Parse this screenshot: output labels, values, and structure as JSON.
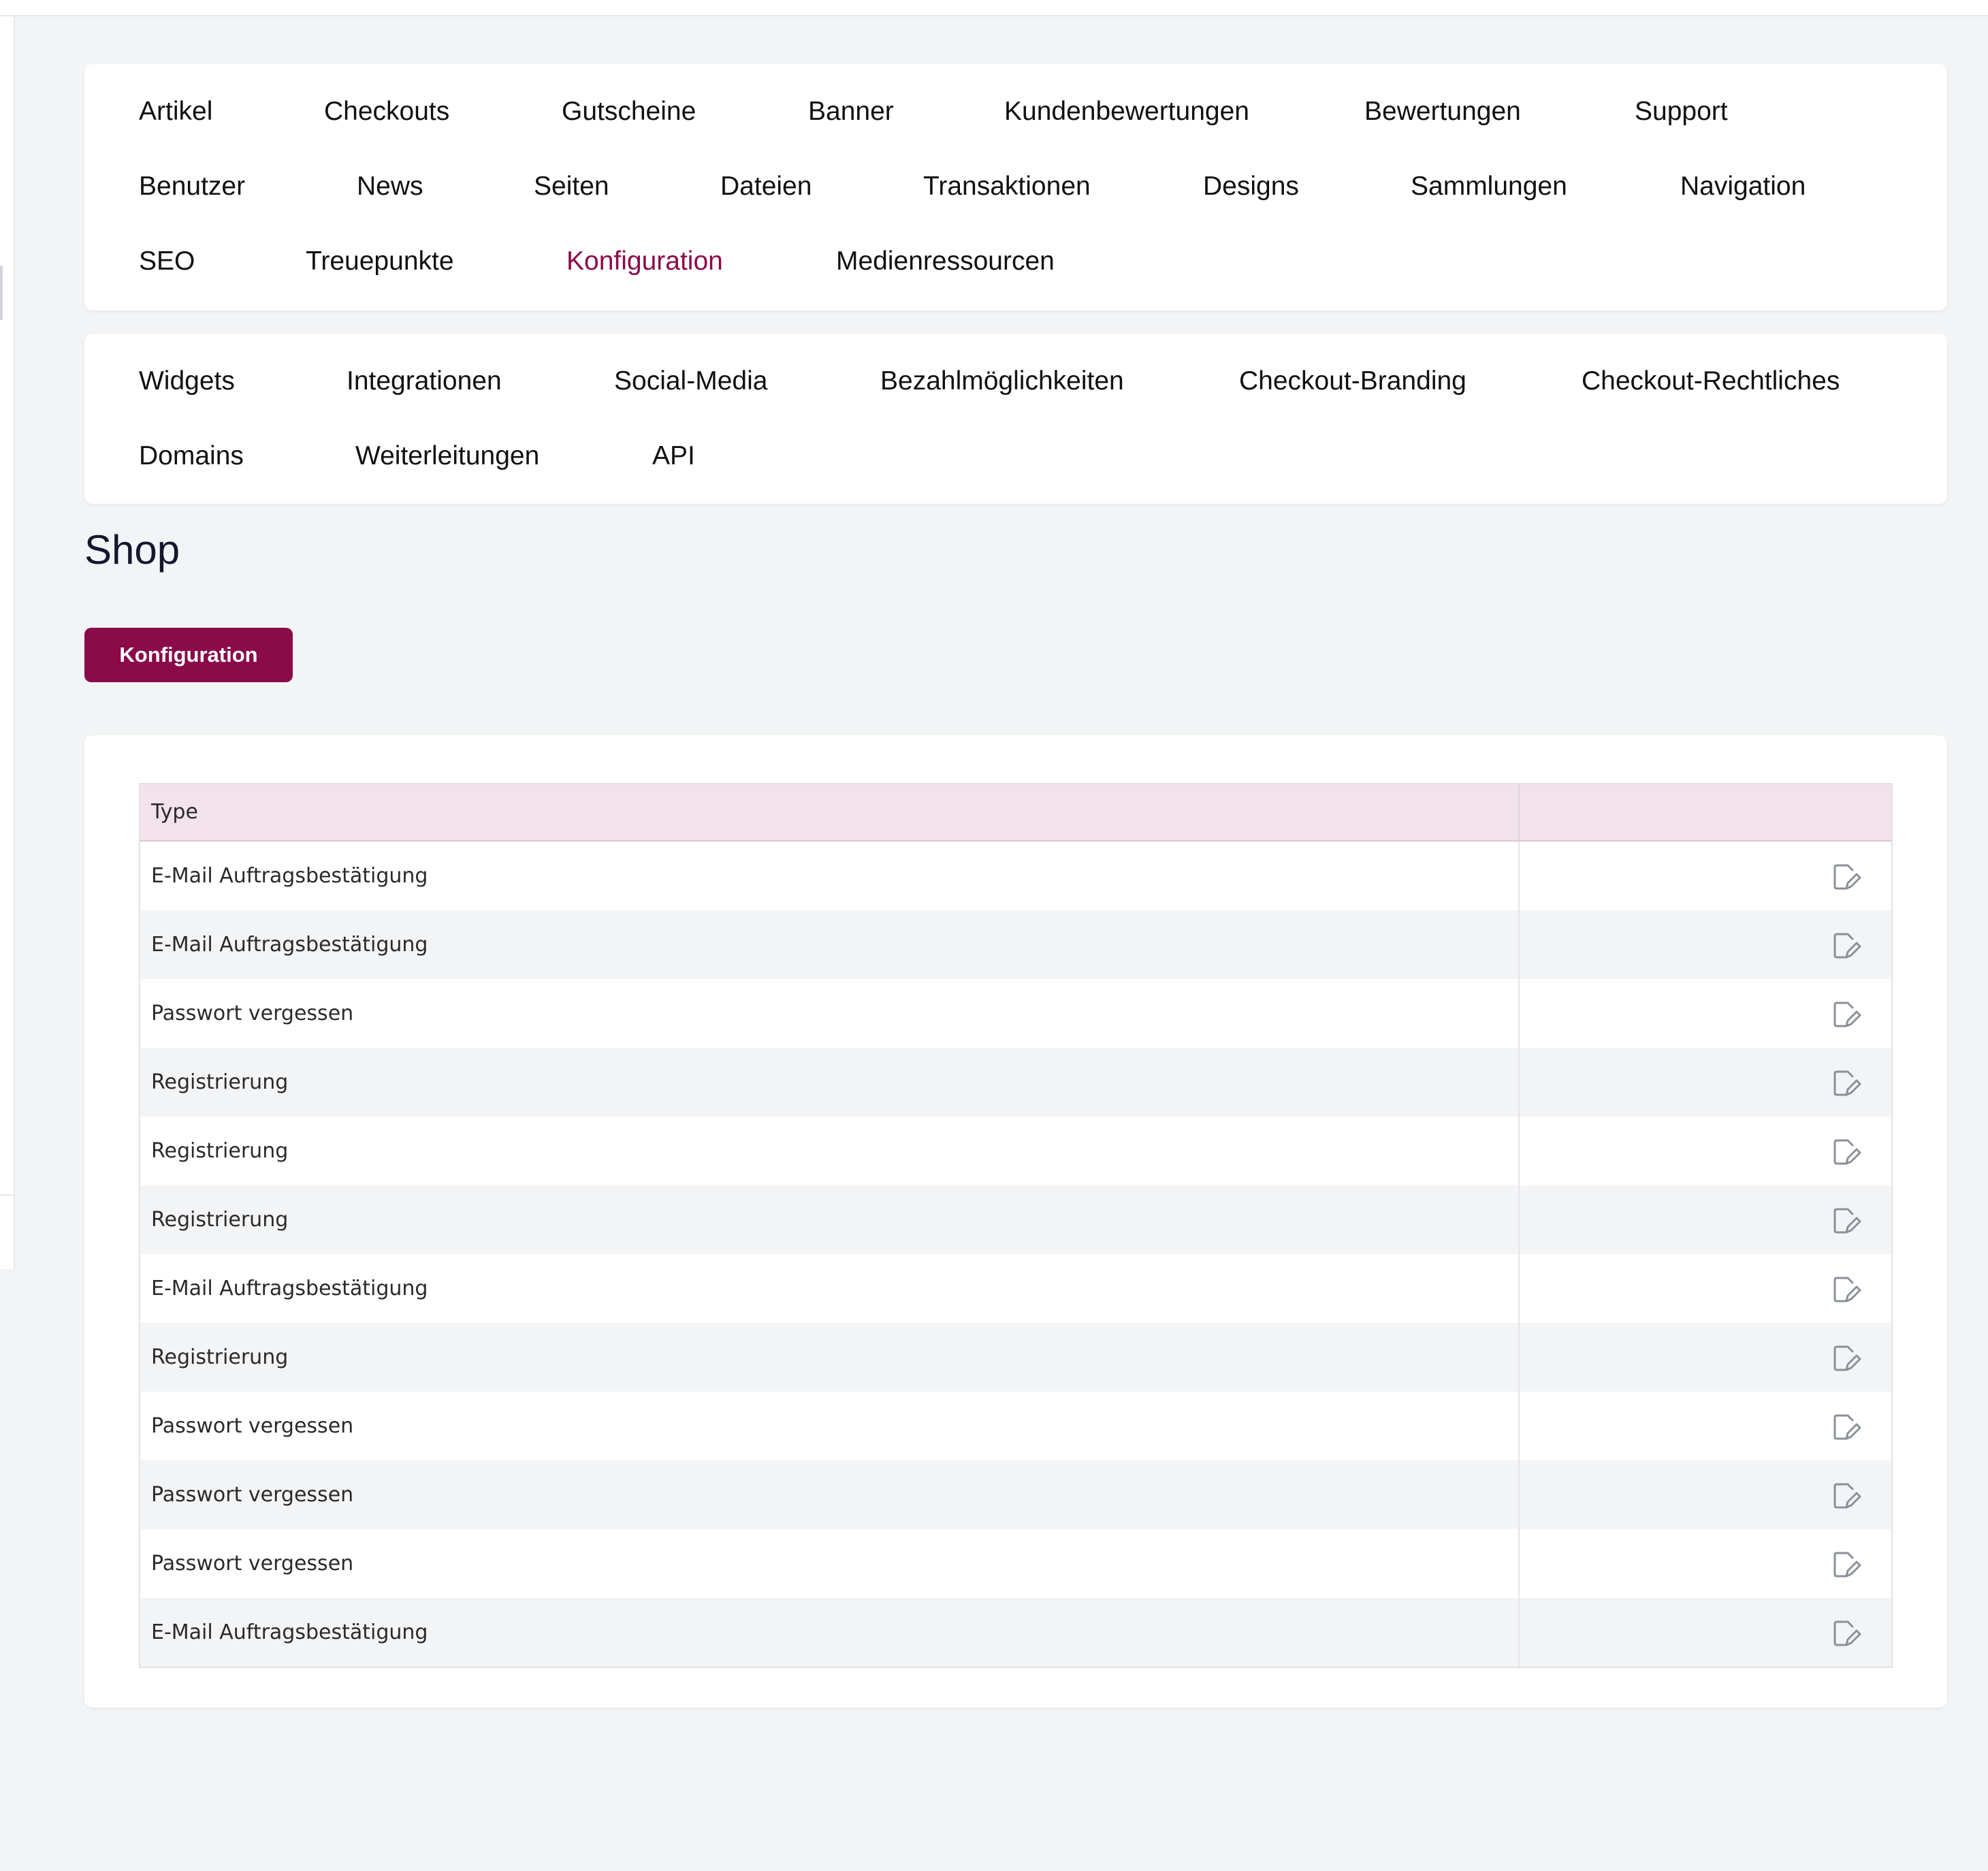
{
  "nav": {
    "items": [
      {
        "label": "Artikel"
      },
      {
        "label": "Checkouts"
      },
      {
        "label": "Gutscheine"
      },
      {
        "label": "Banner"
      },
      {
        "label": "Kundenbewertungen"
      },
      {
        "label": "Bewertungen"
      },
      {
        "label": "Support"
      },
      {
        "label": "Benutzer"
      },
      {
        "label": "News"
      },
      {
        "label": "Seiten"
      },
      {
        "label": "Dateien"
      },
      {
        "label": "Transaktionen"
      },
      {
        "label": "Designs"
      },
      {
        "label": "Sammlungen"
      },
      {
        "label": "Navigation"
      },
      {
        "label": "SEO"
      },
      {
        "label": "Treuepunkte"
      },
      {
        "label": "Konfiguration",
        "active": true
      },
      {
        "label": "Medienressourcen"
      }
    ]
  },
  "subnav": {
    "items": [
      {
        "label": "Widgets"
      },
      {
        "label": "Integrationen"
      },
      {
        "label": "Social-Media"
      },
      {
        "label": "Bezahlmöglichkeiten"
      },
      {
        "label": "Checkout-Branding"
      },
      {
        "label": "Checkout-Rechtliches"
      },
      {
        "label": "Domains"
      },
      {
        "label": "Weiterleitungen"
      },
      {
        "label": "API"
      }
    ]
  },
  "page": {
    "title": "Shop",
    "button_label": "Konfiguration"
  },
  "table": {
    "columns": [
      "Type",
      ""
    ],
    "rows": [
      {
        "type": "E-Mail Auftragsbestätigung"
      },
      {
        "type": "E-Mail Auftragsbestätigung"
      },
      {
        "type": "Passwort vergessen"
      },
      {
        "type": "Registrierung"
      },
      {
        "type": "Registrierung"
      },
      {
        "type": "Registrierung"
      },
      {
        "type": "E-Mail Auftragsbestätigung"
      },
      {
        "type": "Registrierung"
      },
      {
        "type": "Passwort vergessen"
      },
      {
        "type": "Passwort vergessen"
      },
      {
        "type": "Passwort vergessen"
      },
      {
        "type": "E-Mail Auftragsbestätigung"
      }
    ],
    "row_action_icon": "edit-icon"
  },
  "colors": {
    "accent": "#8a0a4a",
    "table_header_bg": "#f1e2ec",
    "page_bg": "#f3f4f6"
  }
}
